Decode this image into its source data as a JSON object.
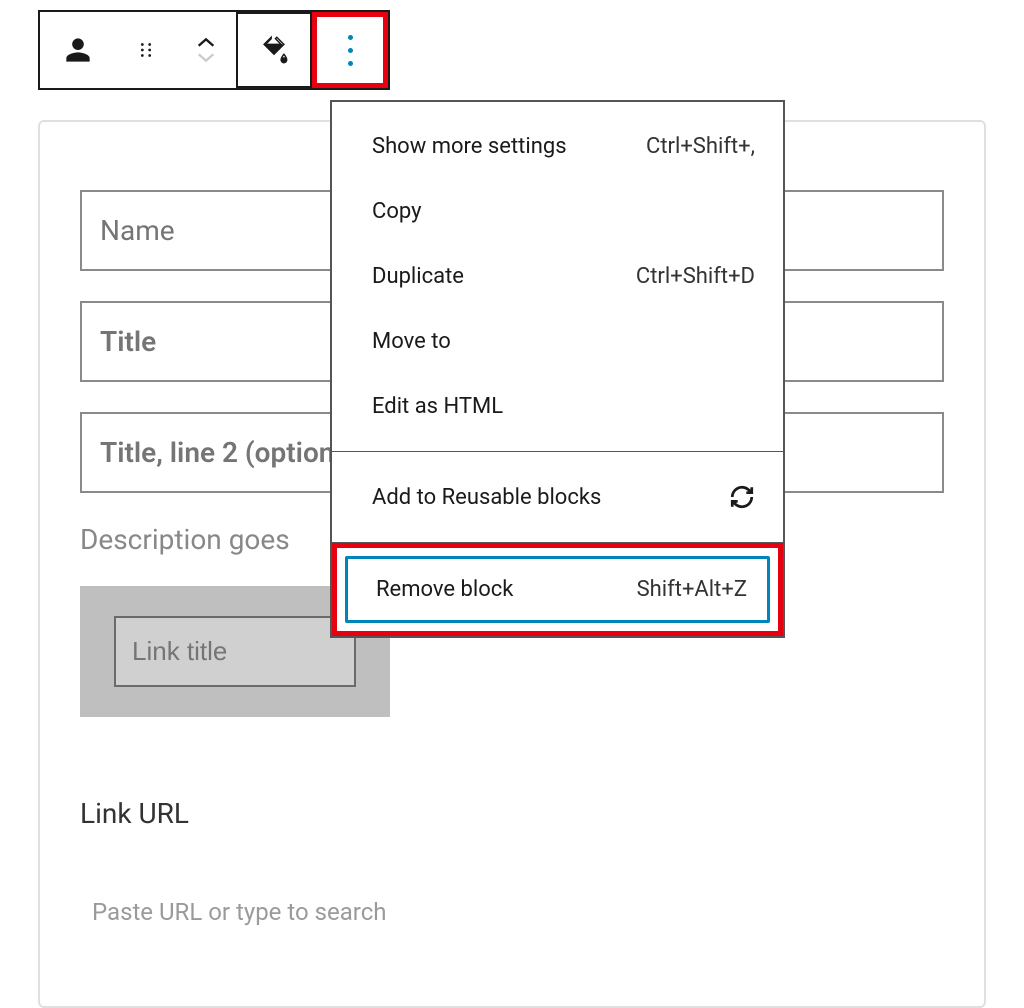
{
  "toolbar": {
    "person_icon": "person",
    "drag_icon": "drag",
    "arrow_up": "up",
    "arrow_down": "down",
    "fill_icon": "fill",
    "more_icon": "more"
  },
  "fields": {
    "name_placeholder": "Name",
    "title_placeholder": "Title",
    "title2_placeholder": "Title, line 2 (optional)",
    "description_label": "Description goes",
    "link_title_placeholder": "Link title",
    "link_url_label": "Link URL",
    "url_placeholder": "Paste URL or type to search"
  },
  "menu": {
    "items": [
      {
        "label": "Show more settings",
        "shortcut": "Ctrl+Shift+,"
      },
      {
        "label": "Copy",
        "shortcut": ""
      },
      {
        "label": "Duplicate",
        "shortcut": "Ctrl+Shift+D"
      },
      {
        "label": "Move to",
        "shortcut": ""
      },
      {
        "label": "Edit as HTML",
        "shortcut": ""
      }
    ],
    "reusable": {
      "label": "Add to Reusable blocks"
    },
    "remove": {
      "label": "Remove block",
      "shortcut": "Shift+Alt+Z"
    }
  }
}
